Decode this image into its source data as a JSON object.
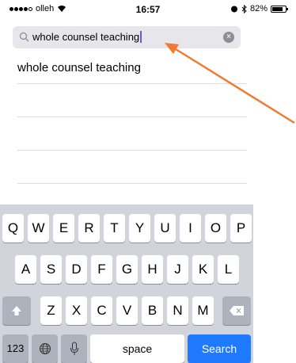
{
  "status": {
    "carrier": "olleh",
    "time": "16:57",
    "battery": "82%",
    "battery_level_percent": 82
  },
  "search": {
    "query": "whole counsel teaching",
    "clear_label": "×"
  },
  "results": [
    "whole counsel teaching",
    "",
    "",
    ""
  ],
  "keyboard": {
    "row1": [
      "Q",
      "W",
      "E",
      "R",
      "T",
      "Y",
      "U",
      "I",
      "O",
      "P"
    ],
    "row2": [
      "A",
      "S",
      "D",
      "F",
      "G",
      "H",
      "J",
      "K",
      "L"
    ],
    "row3": [
      "Z",
      "X",
      "C",
      "V",
      "B",
      "N",
      "M"
    ],
    "numbers_key": "123",
    "space_key": "space",
    "search_key": "Search"
  },
  "colors": {
    "annotation_arrow": "#f07a30",
    "search_key": "#1f7aff",
    "caret": "#5a5fe0"
  }
}
